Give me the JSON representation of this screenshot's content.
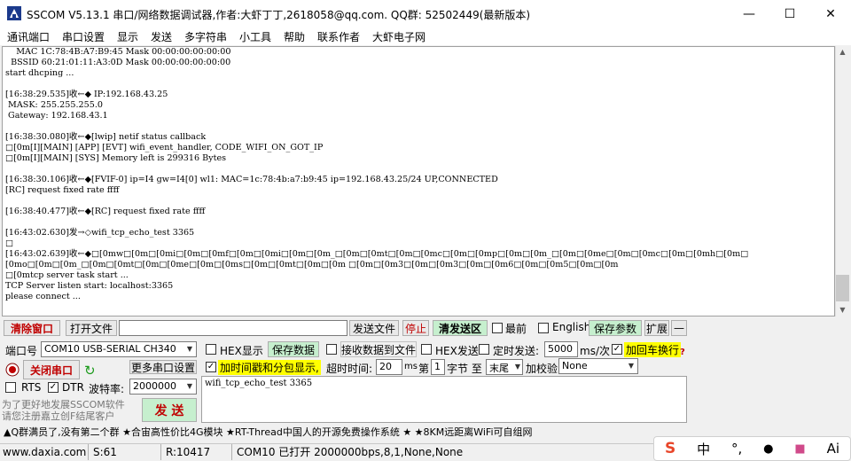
{
  "window": {
    "title": "SSCOM V5.13.1 串口/网络数据调试器,作者:大虾丁丁,2618058@qq.com. QQ群: 52502449(最新版本)",
    "minimize": "—",
    "maximize": "☐",
    "close": "✕"
  },
  "menu": [
    "通讯端口",
    "串口设置",
    "显示",
    "发送",
    "多字符串",
    "小工具",
    "帮助",
    "联系作者",
    "大虾电子网"
  ],
  "log_lines": [
    "    MAC 1C:78:4B:A7:B9:45 Mask 00:00:00:00:00:00",
    "  BSSID 60:21:01:11:A3:0D Mask 00:00:00:00:00:00",
    "start dhcping ...",
    "",
    "[16:38:29.535]收←◆ IP:192.168.43.25",
    " MASK: 255.255.255.0",
    " Gateway: 192.168.43.1",
    "",
    "[16:38:30.080]收←◆[lwip] netif status callback",
    "□[0m[I][MAIN] [APP] [EVT] wifi_event_handler, CODE_WIFI_ON_GOT_IP",
    "□[0m[I][MAIN] [SYS] Memory left is 299316 Bytes",
    "",
    "[16:38:30.106]收←◆[FVIF-0] ip=I4 gw=I4[0] wl1: MAC=1c:78:4b:a7:b9:45 ip=192.168.43.25/24 UP,CONNECTED",
    "[RC] request fixed rate ffff",
    "",
    "[16:38:40.477]收←◆[RC] request fixed rate ffff",
    "",
    "[16:43:02.630]发→◇wifi_tcp_echo_test 3365",
    "□",
    "[16:43:02.639]收←◆□[0mw□[0m□[0mi□[0m□[0mf□[0m□[0mi□[0m□[0m_□[0m□[0mt□[0m□[0mc□[0m□[0mp□[0m□[0m_□[0m□[0me□[0m□[0mc□[0m□[0mh□[0m□",
    "[0mo□[0m□[0m_□[0m□[0mt□[0m□[0me□[0m□[0ms□[0m□[0mt□[0m□[0m □[0m□[0m3□[0m□[0m3□[0m□[0m6□[0m□[0m5□[0m□[0m",
    "□[0mtcp server task start ...",
    "TCP Server listen start: localhost:3365",
    "please connect ..."
  ],
  "toolbar1": {
    "clear_window": "清除窗口",
    "open_file": "打开文件",
    "file_path": "",
    "send_file": "发送文件",
    "stop": "停止",
    "clear_send": "清发送区",
    "topmost": "最前",
    "english": "English",
    "save_params": "保存参数",
    "expand": "扩展",
    "collapse": "—"
  },
  "port": {
    "port_label": "端口号",
    "port_value": "COM10 USB-SERIAL CH340",
    "close_port": "关闭串口",
    "more_settings": "更多串口设置",
    "rts": "RTS",
    "dtr": "DTR",
    "baud_label": "波特率:",
    "baud_value": "2000000",
    "promo": "为了更好地发展SSCOM软件\n请您注册嘉立创F结尾客户",
    "send": "发 送"
  },
  "options": {
    "hex_display": "HEX显示",
    "save_data": "保存数据",
    "recv_to_file": "接收数据到文件",
    "hex_send": "HEX发送",
    "timed_send": "定时发送:",
    "interval": "5000",
    "interval_unit": "ms/次",
    "add_crlf": "加回车换行",
    "timestamp": "加时间戳和分包显示,",
    "timeout_label": "超时时间:",
    "timeout_value": "20",
    "timeout_unit": "ms",
    "byte_prefix": "第",
    "byte_value": "1",
    "byte_label": "字节 至",
    "end_value": "末尾",
    "checksum_label": "加校验",
    "checksum_value": "None"
  },
  "send_text": "wifi_tcp_echo_test 3365",
  "ad": "▲Q群满员了,没有第二个群  ★合宙高性价比4G模块  ★RT-Thread中国人的开源免费操作系统  ★  ★8KM远距离WiFi可自组网",
  "status": {
    "url": "www.daxia.com",
    "s": "S:61",
    "r": "R:10417",
    "port_info": "COM10 已打开  2000000bps,8,1,None,None"
  },
  "ime": [
    "中",
    "°,",
    "🎤",
    "👕",
    "Ai"
  ],
  "colors": {
    "green_btn_bg": "#c6efce",
    "yellow_hl": "#ffff00",
    "red_text": "#c00000"
  }
}
